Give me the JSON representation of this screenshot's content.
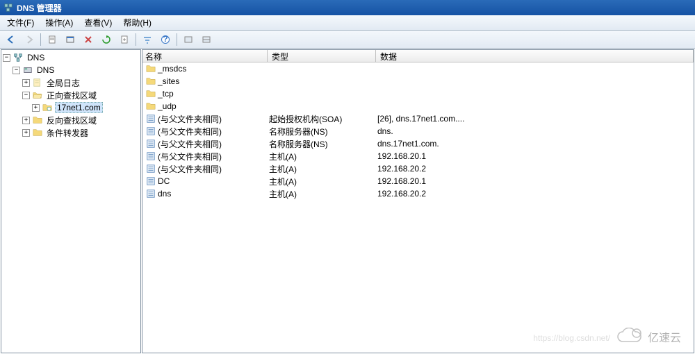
{
  "title": "DNS 管理器",
  "menu": {
    "file": "文件(F)",
    "action": "操作(A)",
    "view": "查看(V)",
    "help": "帮助(H)"
  },
  "tree": {
    "root": "DNS",
    "server": "DNS",
    "global_log": "全局日志",
    "forward_zones": "正向查找区域",
    "zone_name": "17net1.com",
    "reverse_zones": "反向查找区域",
    "conditional_forwarders": "条件转发器"
  },
  "columns": {
    "name": "名称",
    "type": "类型",
    "data": "数据"
  },
  "records": [
    {
      "name": "_msdcs",
      "type": "",
      "data": "",
      "icon": "folder"
    },
    {
      "name": "_sites",
      "type": "",
      "data": "",
      "icon": "folder"
    },
    {
      "name": "_tcp",
      "type": "",
      "data": "",
      "icon": "folder"
    },
    {
      "name": "_udp",
      "type": "",
      "data": "",
      "icon": "folder"
    },
    {
      "name": "(与父文件夹相同)",
      "type": "起始授权机构(SOA)",
      "data": "[26], dns.17net1.com....",
      "icon": "record"
    },
    {
      "name": "(与父文件夹相同)",
      "type": "名称服务器(NS)",
      "data": "dns.",
      "icon": "record"
    },
    {
      "name": "(与父文件夹相同)",
      "type": "名称服务器(NS)",
      "data": "dns.17net1.com.",
      "icon": "record"
    },
    {
      "name": "(与父文件夹相同)",
      "type": "主机(A)",
      "data": "192.168.20.1",
      "icon": "record"
    },
    {
      "name": "(与父文件夹相同)",
      "type": "主机(A)",
      "data": "192.168.20.2",
      "icon": "record"
    },
    {
      "name": "DC",
      "type": "主机(A)",
      "data": "192.168.20.1",
      "icon": "record"
    },
    {
      "name": "dns",
      "type": "主机(A)",
      "data": "192.168.20.2",
      "icon": "record"
    }
  ],
  "watermark": {
    "text": "亿速云",
    "url": "https://blog.csdn.net/"
  }
}
